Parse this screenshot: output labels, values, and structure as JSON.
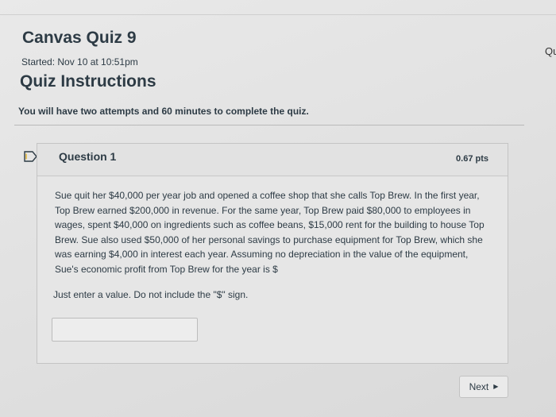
{
  "page": {
    "quiz_title": "Canvas Quiz 9",
    "started": "Started: Nov 10 at 10:51pm",
    "instructions_heading": "Quiz Instructions",
    "instructions_text": "You will have two attempts and 60 minutes to complete the quiz.",
    "edge_text": "Qu"
  },
  "question": {
    "title": "Question 1",
    "points": "0.67 pts",
    "body": "Sue quit her $40,000 per year job and opened a coffee shop that she calls Top Brew. In the first year, Top Brew earned $200,000 in revenue. For the same year, Top Brew paid $80,000 to employees in wages, spent $40,000 on ingredients such as coffee beans, $15,000 rent for the building to house Top Brew. Sue also used $50,000 of her personal savings to purchase equipment for Top Brew, which she was earning $4,000 in interest each year. Assuming no depreciation in the value of the equipment, Sue's economic profit from Top Brew for the year is $",
    "note": "Just enter a value.  Do not include the \"$\" sign.",
    "answer_value": "",
    "answer_placeholder": ""
  },
  "navigation": {
    "next_label": "Next",
    "next_icon": "triangle-right-icon"
  },
  "colors": {
    "text": "#2d3b45",
    "flag_accent": "#e0b024",
    "border": "#c4c4c4"
  },
  "icons": {
    "flag": "flag-icon"
  }
}
